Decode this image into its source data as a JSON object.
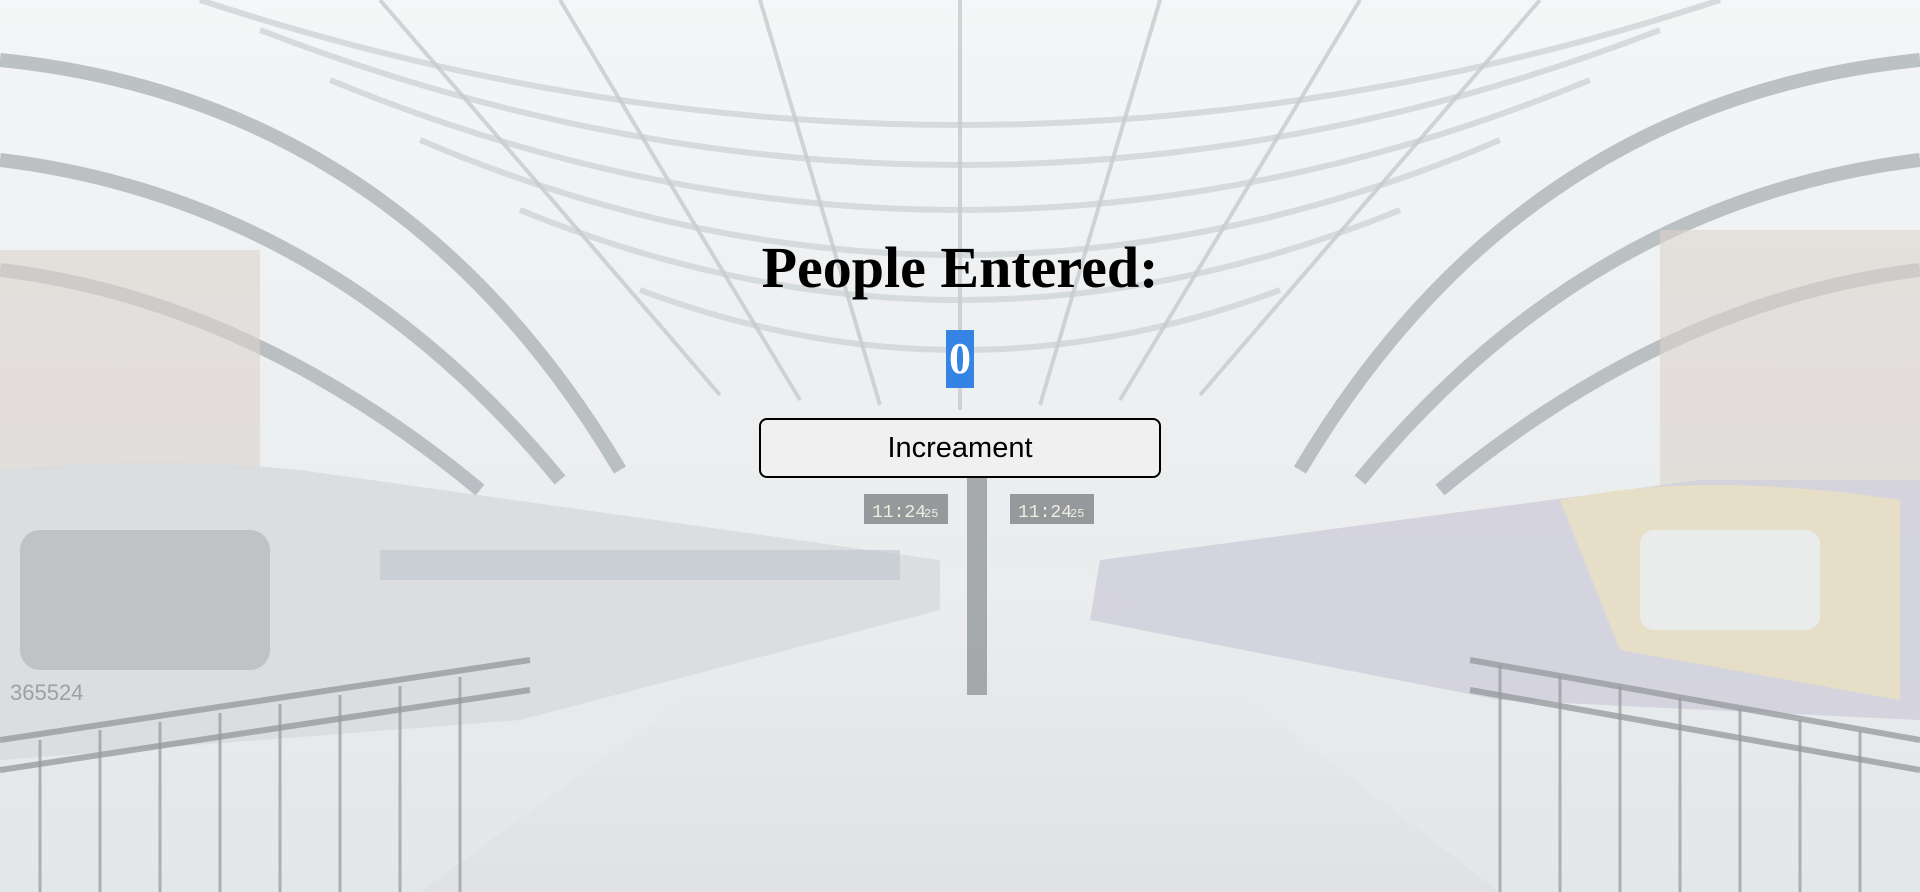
{
  "heading": "People Entered:",
  "counter": {
    "value": "0"
  },
  "increment_button": {
    "label": "Increament"
  },
  "background": {
    "train_number": "365524",
    "clock_1": "11:24",
    "clock_1_seconds": "25",
    "clock_2": "11:24",
    "clock_2_seconds": "25"
  },
  "colors": {
    "counter_highlight": "#3584e4",
    "button_bg": "#f0f0f0",
    "overlay": "#dfe3e6"
  }
}
